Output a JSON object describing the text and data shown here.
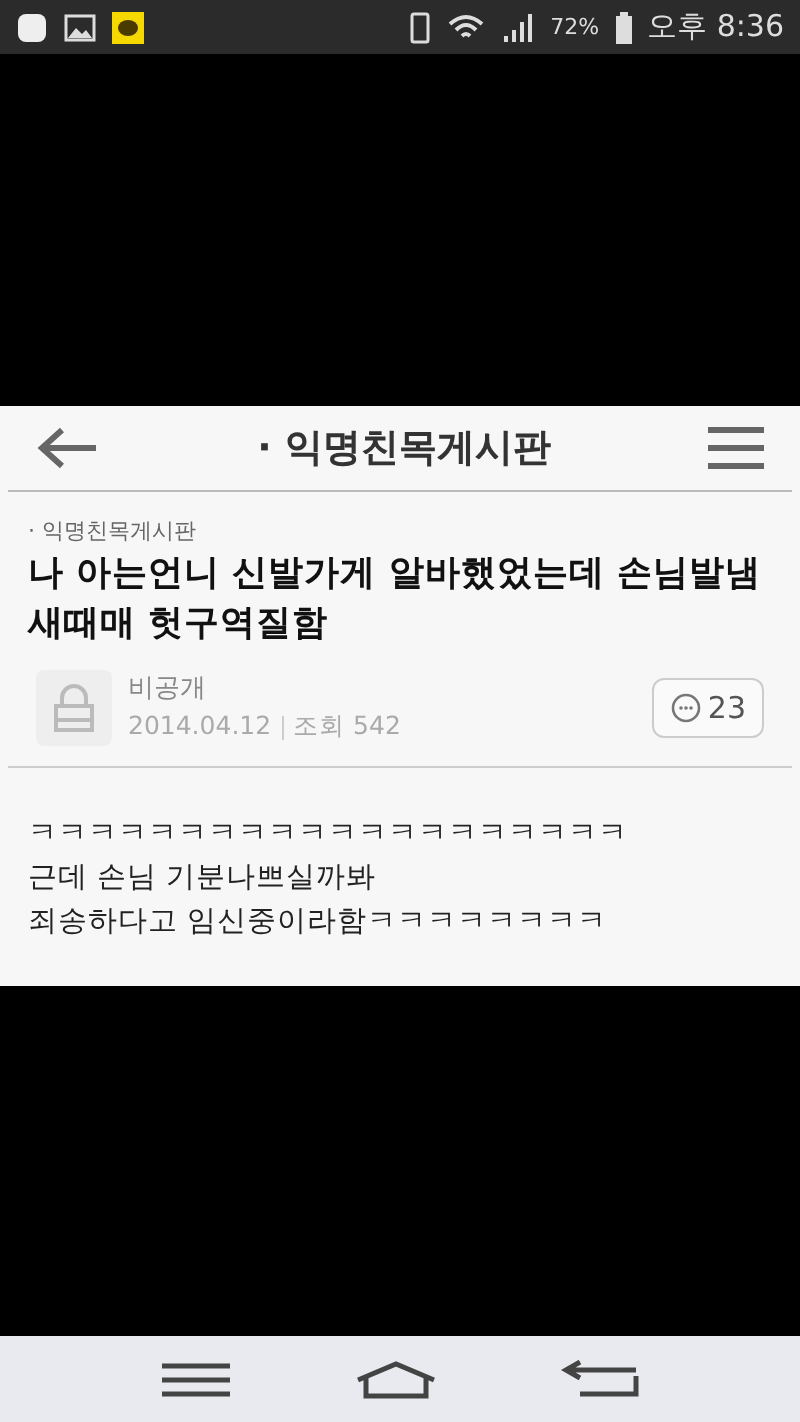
{
  "status_bar": {
    "battery": "72%",
    "time": "오후 8:36"
  },
  "header": {
    "title": "· 익명친목게시판"
  },
  "post": {
    "board": "· 익명친목게시판",
    "title": "나 아는언니 신발가게 알바했었는데 손님발냄새때매 헛구역질함",
    "author": "비공개",
    "date": "2014.04.12",
    "views": "조회 542",
    "comments": "23",
    "body": [
      "ㅋㅋㅋㅋㅋㅋㅋㅋㅋㅋㅋㅋㅋㅋㅋㅋㅋㅋㅋㅋ",
      "근데 손님 기분나쁘실까봐",
      "죄송하다고 임신중이라함ㅋㅋㅋㅋㅋㅋㅋㅋ"
    ]
  }
}
